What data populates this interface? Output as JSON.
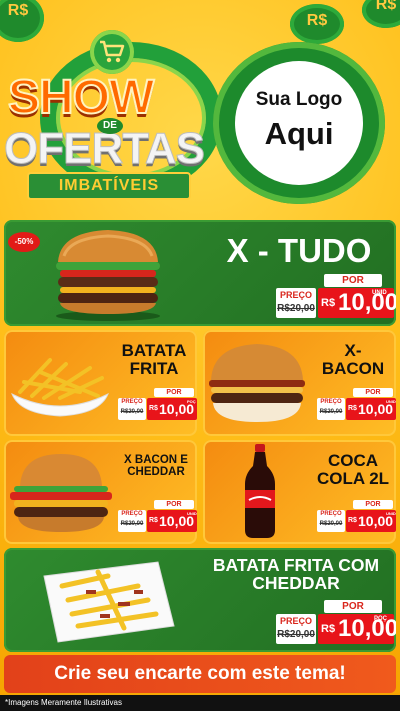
{
  "header": {
    "coin_symbol": "R$",
    "title_show": "SHOW",
    "title_de": "DE",
    "title_ofertas": "OFERTAS",
    "title_imbativeis": "IMBATÍVEIS",
    "logo_line1": "Sua Logo",
    "logo_line2": "Aqui"
  },
  "products": [
    {
      "name": "X - TUDO",
      "badge": "-50%",
      "por": "POR",
      "preco": "PREÇO",
      "old_price": "R$20,00",
      "currency": "R$",
      "price": "10,00",
      "unit": "UNID"
    },
    {
      "name_l1": "BATATA",
      "name_l2": "FRITA",
      "por": "POR",
      "preco": "PREÇO",
      "old_price": "R$20,00",
      "currency": "R$",
      "price": "10,00",
      "unit": "POÇ"
    },
    {
      "name_l1": "X-",
      "name_l2": "BACON",
      "por": "POR",
      "preco": "PREÇO",
      "old_price": "R$20,00",
      "currency": "R$",
      "price": "10,00",
      "unit": "UNID"
    },
    {
      "name_l1": "X BACON E",
      "name_l2": "CHEDDAR",
      "por": "POR",
      "preco": "PREÇO",
      "old_price": "R$20,00",
      "currency": "R$",
      "price": "10,00",
      "unit": "UNID"
    },
    {
      "name_l1": "COCA",
      "name_l2": "COLA 2L",
      "por": "POR",
      "preco": "PREÇO",
      "old_price": "R$20,00",
      "currency": "R$",
      "price": "10,00",
      "unit": "UNID"
    },
    {
      "name_l1": "BATATA FRITA COM",
      "name_l2": "CHEDDAR",
      "por": "POR",
      "preco": "PREÇO",
      "old_price": "R$20,00",
      "currency": "R$",
      "price": "10,00",
      "unit": "POÇ"
    }
  ],
  "cta": "Crie seu encarte com este tema!",
  "footer": "*Imagens Meramente Ilustrativas",
  "colors": {
    "green": "#2f8b2f",
    "orange": "#f48b10",
    "red": "#e8141a",
    "yellow": "#ffc940"
  }
}
